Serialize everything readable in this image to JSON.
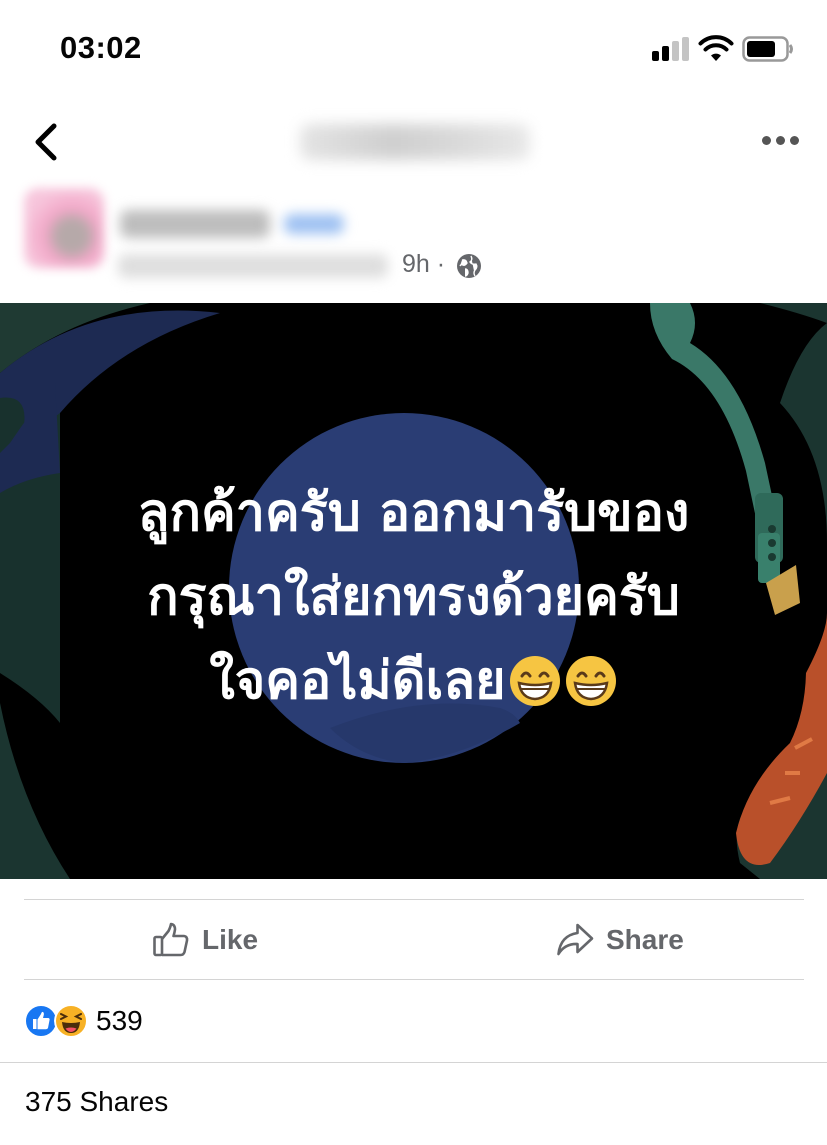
{
  "status_bar": {
    "time": "03:02",
    "signal_icon": "cellular-signal-icon",
    "wifi_icon": "wifi-icon",
    "battery_icon": "battery-icon"
  },
  "nav": {
    "back_icon": "chevron-left-icon",
    "title": "",
    "more_icon": "ellipsis-icon"
  },
  "post": {
    "author_name": "",
    "author_subtitle": "",
    "time": "9h ·",
    "privacy_icon": "globe-icon",
    "image_text_lines": [
      "ลูกค้าครับ ออกมารับของ",
      "กรุณาใส่ยกทรงด้วยครับ",
      "ใจคอไม่ดีเลย"
    ],
    "image_emoji": "grinning-face-emoji"
  },
  "actions": {
    "like_label": "Like",
    "like_icon": "thumbs-up-icon",
    "share_label": "Share",
    "share_icon": "share-arrow-icon"
  },
  "reactions": {
    "like_icon": "like-reaction-icon",
    "haha_icon": "haha-reaction-icon",
    "count": "539"
  },
  "shares": {
    "label": "375 Shares"
  },
  "colors": {
    "like_blue": "#1877f2",
    "muted_text": "#65676b",
    "haha_yellow": "#f7b125"
  }
}
